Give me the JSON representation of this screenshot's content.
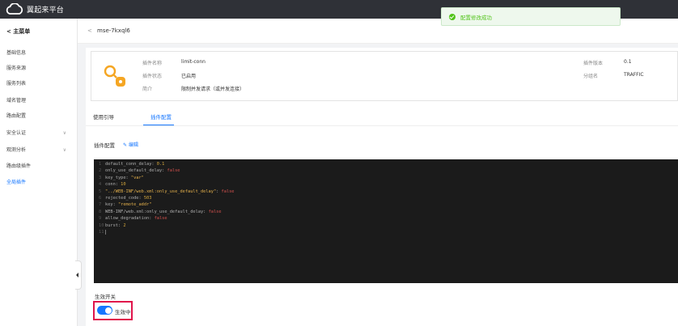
{
  "app": {
    "brand": "翼起来平台"
  },
  "toast": {
    "message": "配置修改成功"
  },
  "sidebar": {
    "title": "< 主菜单",
    "items": [
      {
        "label": "基础信息",
        "chevron": ""
      },
      {
        "label": "服务来源",
        "chevron": ""
      },
      {
        "label": "服务列表",
        "chevron": ""
      },
      {
        "label": "域名管理",
        "chevron": ""
      },
      {
        "label": "路由配置",
        "chevron": ""
      },
      {
        "label": "安全认证",
        "chevron": "∨"
      },
      {
        "label": "观测分析",
        "chevron": "∨"
      },
      {
        "label": "路由级插件",
        "chevron": ""
      },
      {
        "label": "全局插件",
        "chevron": ""
      }
    ],
    "active_index": 8
  },
  "breadcrumb": {
    "back": "<",
    "title": "mse-7kxql6"
  },
  "plugin": {
    "name_label": "插件名称",
    "name": "limit-conn",
    "status_label": "插件状态",
    "status": "已启用",
    "desc_label": "简介",
    "desc": "限制并发请求（或并发连接）",
    "version_label": "插件版本",
    "version": "0.1",
    "group_label": "分组名",
    "group": "TRAFFIC"
  },
  "tabs": [
    {
      "label": "使用引导"
    },
    {
      "label": "插件配置"
    }
  ],
  "active_tab": 1,
  "config": {
    "title": "插件配置",
    "edit_label": "编辑",
    "lines": [
      {
        "n": "1",
        "parts": [
          [
            "k",
            "default_conn_delay: "
          ],
          [
            "num",
            "0.1"
          ]
        ]
      },
      {
        "n": "2",
        "parts": [
          [
            "k",
            "only_use_default_delay: "
          ],
          [
            "bool",
            "false"
          ]
        ]
      },
      {
        "n": "3",
        "parts": [
          [
            "k",
            "key_type: "
          ],
          [
            "str",
            "\"var\""
          ]
        ]
      },
      {
        "n": "4",
        "parts": [
          [
            "k",
            "conn: "
          ],
          [
            "num",
            "10"
          ]
        ]
      },
      {
        "n": "5",
        "parts": [
          [
            "str",
            "\"../WEB-INF/web.xml:only_use_default_delay\""
          ],
          [
            "k",
            ": "
          ],
          [
            "bool",
            "false"
          ]
        ]
      },
      {
        "n": "6",
        "parts": [
          [
            "k",
            "rejected_code: "
          ],
          [
            "num",
            "503"
          ]
        ]
      },
      {
        "n": "7",
        "parts": [
          [
            "k",
            "key: "
          ],
          [
            "str",
            "\"remote_addr\""
          ]
        ]
      },
      {
        "n": "8",
        "parts": [
          [
            "k",
            "WEB-INF/web.xml:only_use_default_delay: "
          ],
          [
            "bool",
            "false"
          ]
        ]
      },
      {
        "n": "9",
        "parts": [
          [
            "k",
            "allow_degradation: "
          ],
          [
            "bool",
            "false"
          ]
        ]
      },
      {
        "n": "10",
        "parts": [
          [
            "k",
            "burst: "
          ],
          [
            "num",
            "2"
          ]
        ]
      },
      {
        "n": "11",
        "parts": []
      }
    ]
  },
  "switch": {
    "label": "生效开关",
    "state_label": "生效中",
    "on": true
  },
  "colors": {
    "accent": "#1677ff",
    "topbar": "#2f3137",
    "success": "#52c41a",
    "highlight": "#e0144b",
    "code_bg": "#1b1b1b"
  },
  "icons": {
    "logo": "cloud-icon",
    "toast": "check-circle-icon",
    "plugin": "key-icon",
    "edit": "pencil-icon",
    "collapse": "caret-left-icon"
  }
}
